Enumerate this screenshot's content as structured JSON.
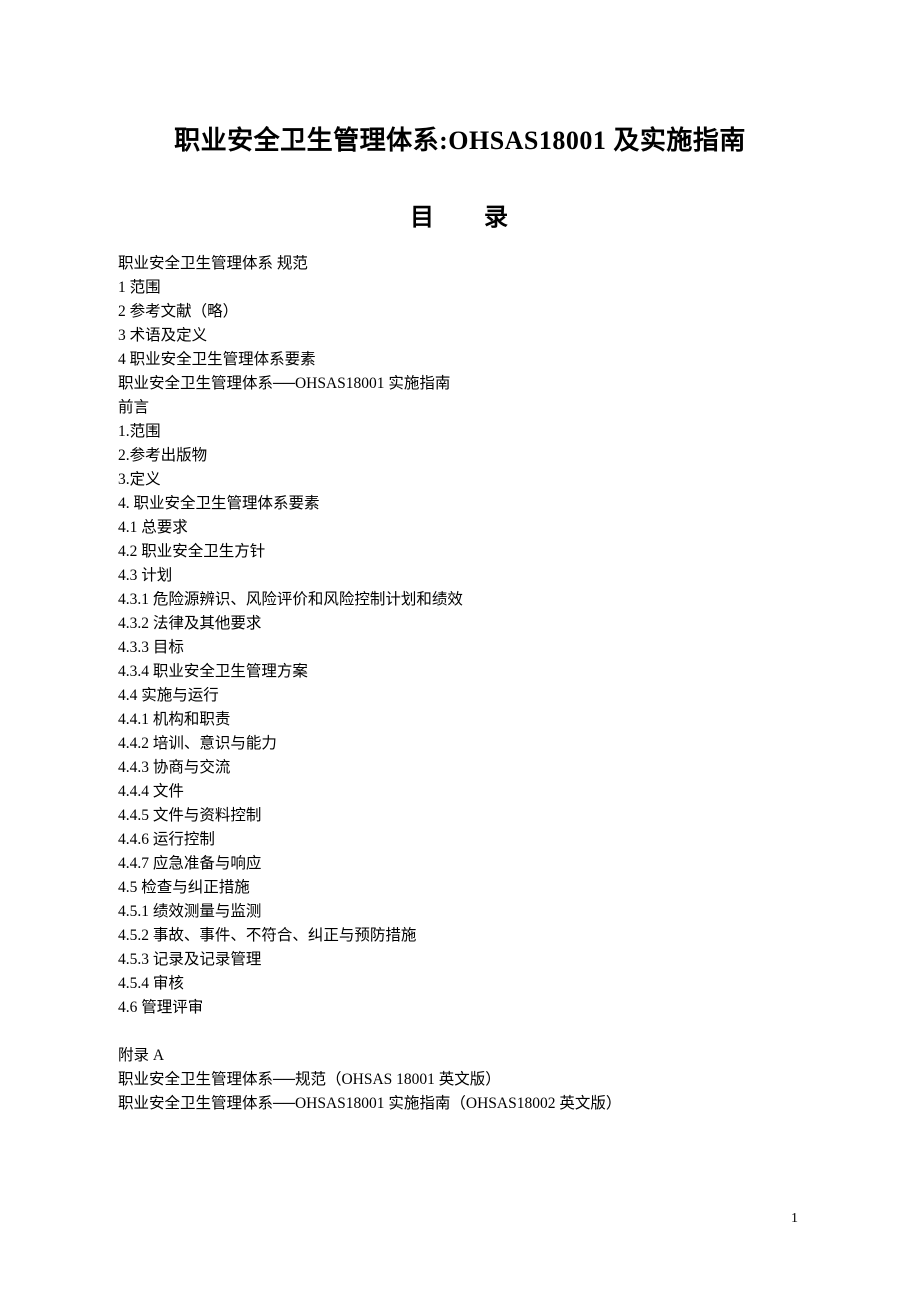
{
  "title": "职业安全卫生管理体系:OHSAS18001 及实施指南",
  "toc_heading_left": "目",
  "toc_heading_right": "录",
  "toc_items": [
    "职业安全卫生管理体系 规范",
    "1 范围",
    "2 参考文献（略）",
    "3 术语及定义",
    "4 职业安全卫生管理体系要素",
    "职业安全卫生管理体系──OHSAS18001 实施指南",
    "前言",
    "1.范围",
    "2.参考出版物",
    "3.定义",
    "4.  职业安全卫生管理体系要素",
    "4.1 总要求",
    "4.2 职业安全卫生方针",
    "4.3 计划",
    "4.3.1 危险源辨识、风险评价和风险控制计划和绩效",
    "4.3.2 法律及其他要求",
    "4.3.3 目标",
    "4.3.4 职业安全卫生管理方案",
    "4.4 实施与运行",
    "4.4.1 机构和职责",
    "4.4.2 培训、意识与能力",
    "4.4.3 协商与交流",
    "4.4.4 文件",
    "4.4.5 文件与资料控制",
    "4.4.6 运行控制",
    "4.4.7 应急准备与响应",
    "4.5 检查与纠正措施",
    "4.5.1 绩效测量与监测",
    "4.5.2 事故、事件、不符合、纠正与预防措施",
    "4.5.3 记录及记录管理",
    "4.5.4 审核",
    "4.6 管理评审"
  ],
  "appendix_items": [
    "附录 A",
    "职业安全卫生管理体系──规范（OHSAS 18001 英文版）",
    "职业安全卫生管理体系──OHSAS18001 实施指南（OHSAS18002 英文版）"
  ],
  "page_number": "1"
}
